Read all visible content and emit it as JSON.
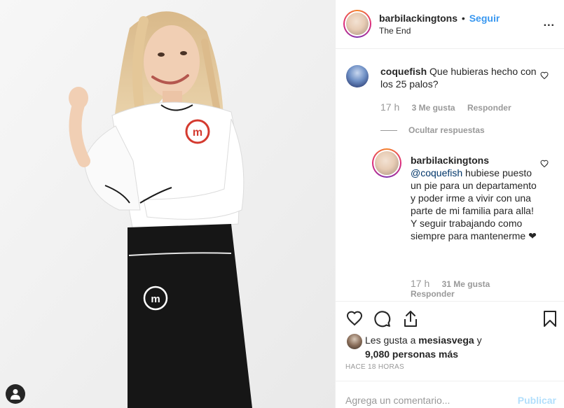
{
  "header": {
    "username": "barbilackingtons",
    "separator": "•",
    "follow_label": "Seguir",
    "subtitle": "The End",
    "more_label": "..."
  },
  "comments": [
    {
      "username": "coquefish",
      "text": "Que hubieras hecho con los 25 palos?",
      "time": "17 h",
      "likes": "3 Me gusta",
      "reply_label": "Responder"
    }
  ],
  "hide_replies_label": "Ocultar respuestas",
  "reply": {
    "username": "barbilackingtons",
    "mention": "@coquefish",
    "text": "hubiese puesto un pie para un departamento y poder irme a vivir con una parte de mi familia para alla! Y seguir trabajando como siempre para mantenerme ❤",
    "time": "17 h",
    "likes": "31 Me gusta",
    "reply_label": "Responder"
  },
  "likes": {
    "prefix": "Les gusta a",
    "user": "mesiasvega",
    "connector": "y",
    "others": "9,080 personas más"
  },
  "time_ago": "HACE 18 HORAS",
  "comment_box": {
    "placeholder": "Agrega un comentario...",
    "publish_label": "Publicar"
  },
  "icons": {
    "like": "heart-icon",
    "comment": "comment-icon",
    "share": "share-icon",
    "save": "bookmark-icon",
    "tag": "user-tag-icon"
  },
  "colors": {
    "accent": "#3897f0",
    "text": "#262626",
    "muted": "#999999",
    "mention": "#003569",
    "publish_disabled": "#b2dffc"
  }
}
